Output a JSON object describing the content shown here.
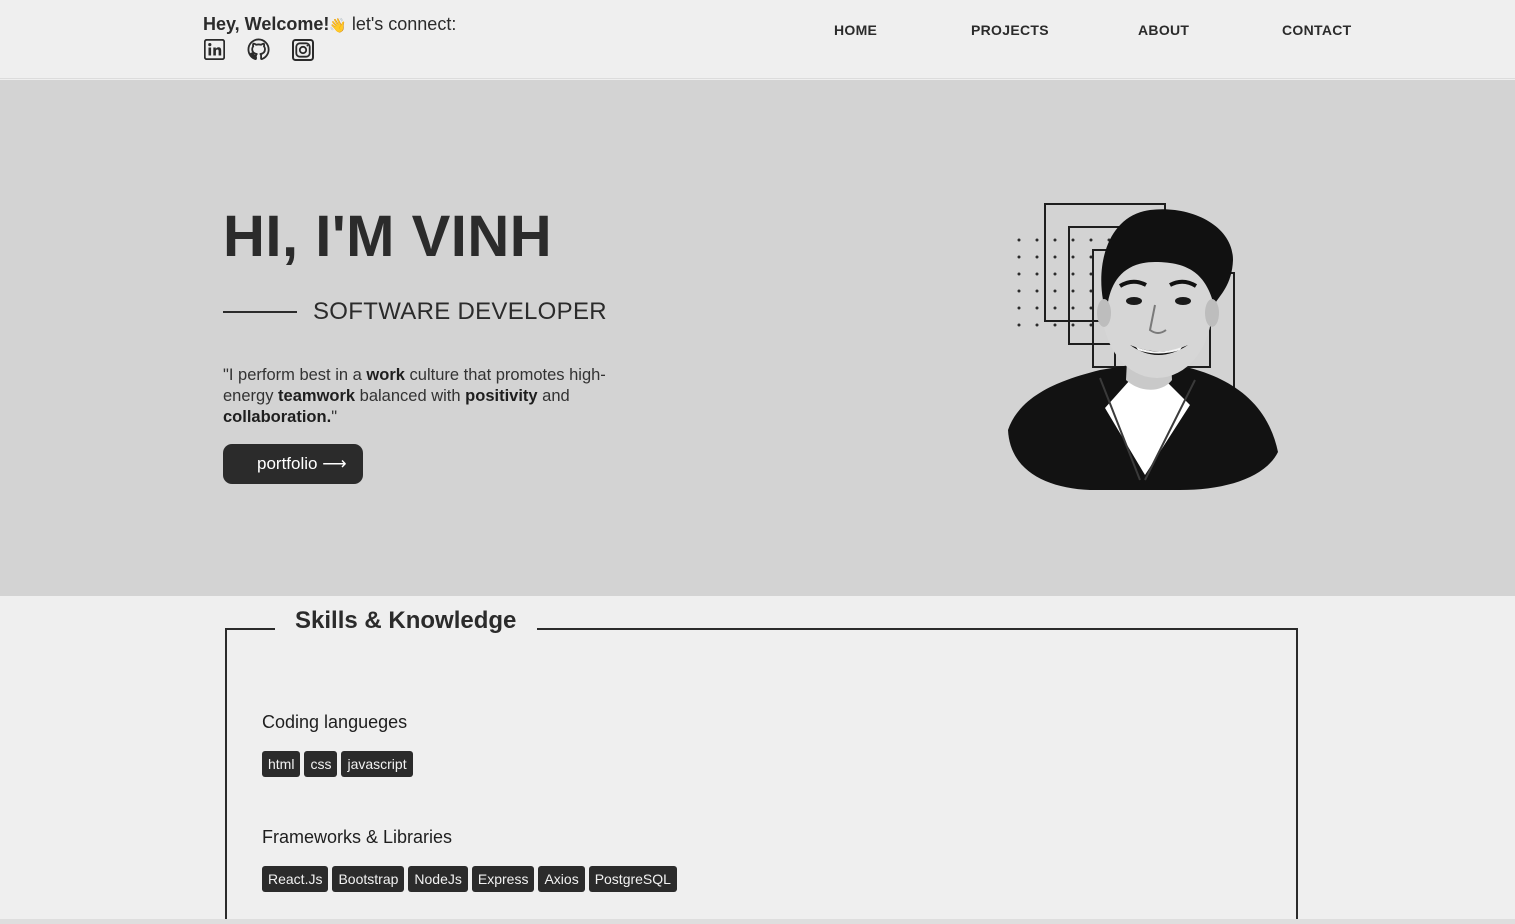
{
  "header": {
    "welcome_bold": "Hey, Welcome!",
    "welcome_icon": "👋",
    "welcome_rest": " let's connect:",
    "socials": [
      {
        "name": "linkedin-icon"
      },
      {
        "name": "github-icon"
      },
      {
        "name": "instagram-icon"
      }
    ],
    "nav": {
      "home": "HOME",
      "projects": "PROJECTS",
      "about": "ABOUT",
      "contact": "CONTACT"
    }
  },
  "hero": {
    "title": "HI, I'M VINH",
    "subtitle": "SOFTWARE DEVELOPER",
    "quote_parts": {
      "p1": "\"I perform best in a ",
      "b1": "work",
      "p2": " culture that promotes high-energy ",
      "b2": "teamwork",
      "p3": " balanced with ",
      "b3": "positivity",
      "p4": " and ",
      "b4": "collaboration.",
      "p5": "\""
    },
    "button_label": "portfolio ⟶"
  },
  "skills": {
    "title": "Skills & Knowledge",
    "categories": [
      {
        "title": "Coding langueges",
        "tags": [
          "html",
          "css",
          "javascript"
        ]
      },
      {
        "title": "Frameworks & Libraries",
        "tags": [
          "React.Js",
          "Bootstrap",
          "NodeJs",
          "Express",
          "Axios",
          "PostgreSQL"
        ]
      }
    ]
  },
  "colors": {
    "background": "#efefef",
    "hero_background": "#d3d3d3",
    "dark": "#2b2b2b"
  }
}
